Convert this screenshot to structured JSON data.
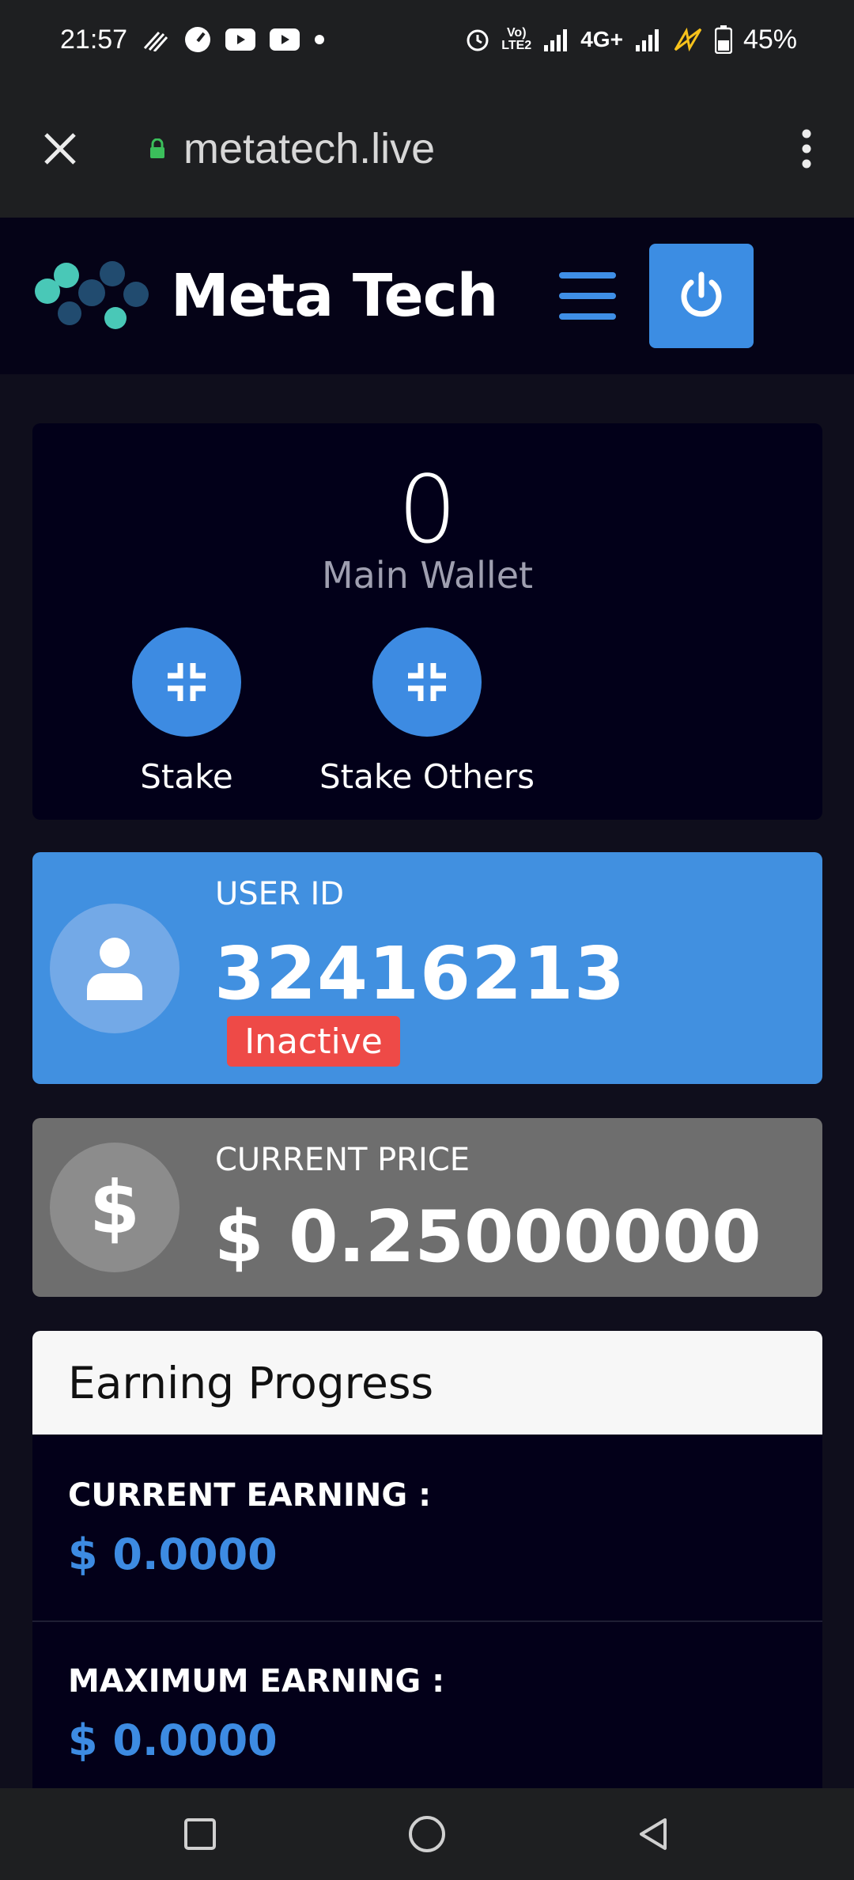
{
  "status_bar": {
    "time": "21:57",
    "network": "4G+",
    "volte": "Vo) LTE2",
    "battery": "45%"
  },
  "browser": {
    "url": "metatech.live"
  },
  "header": {
    "brand": "Meta Tech"
  },
  "wallet": {
    "value": "0",
    "label": "Main Wallet",
    "actions": [
      {
        "label": "Stake"
      },
      {
        "label": "Stake Others"
      }
    ]
  },
  "user": {
    "label": "USER ID",
    "id": "32416213",
    "status": "Inactive"
  },
  "price": {
    "label": "CURRENT PRICE",
    "value": "$ 0.25000000"
  },
  "earning": {
    "title": "Earning Progress",
    "rows": [
      {
        "label": "CURRENT EARNING :",
        "value": "$ 0.0000"
      },
      {
        "label": "MAXIMUM EARNING :",
        "value": "$ 0.0000"
      }
    ]
  },
  "colors": {
    "accent": "#3d8be2",
    "user_card": "#4190e0",
    "price_card": "#6e6e6e",
    "inactive_badge": "#ee4a47",
    "background": "#0f0e1c"
  }
}
